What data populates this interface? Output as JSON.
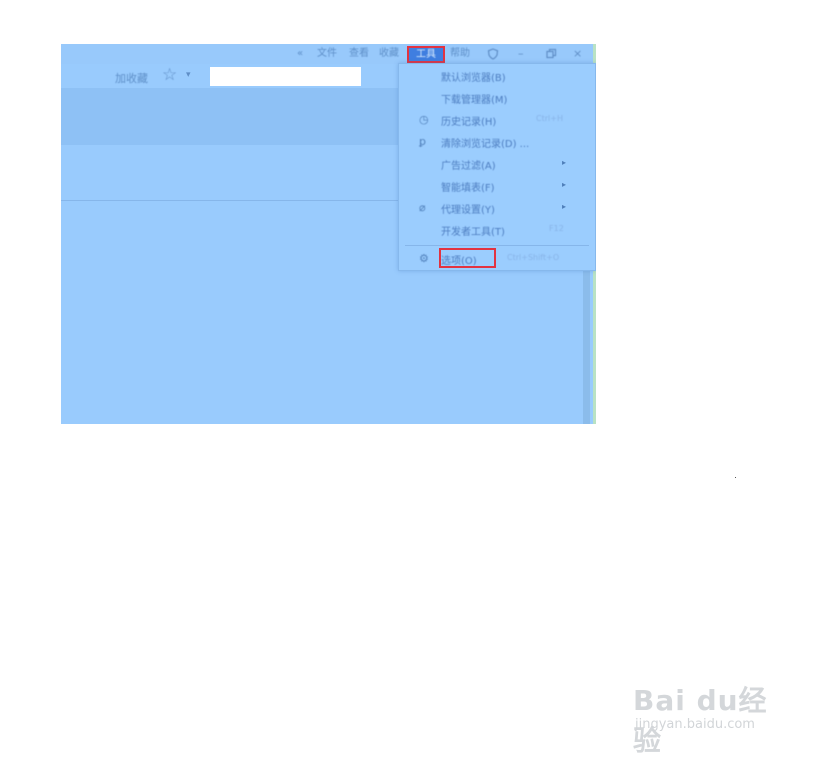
{
  "menubar": {
    "collapse_icon": "double-chevron-icon",
    "items": [
      "文件",
      "查看",
      "收藏"
    ],
    "tools_label": "工具",
    "help_label": "帮助",
    "shield_icon": "shield-icon",
    "minimize": "–",
    "restore": "▫",
    "close": "×"
  },
  "toolbar": {
    "favorites_label": "加收藏",
    "star_icon": "star-icon",
    "caret": "▾"
  },
  "tools_menu": {
    "items": [
      {
        "icon": "",
        "label": "默认浏览器(B)",
        "shortcut": "",
        "submenu": false
      },
      {
        "icon": "",
        "label": "下载管理器(M)",
        "shortcut": "",
        "submenu": false
      },
      {
        "icon": "clock-icon",
        "label": "历史记录(H)",
        "shortcut": "Ctrl+H",
        "submenu": false
      },
      {
        "icon": "broom-icon",
        "label": "清除浏览记录(D) ...",
        "shortcut": "",
        "submenu": false
      },
      {
        "icon": "",
        "label": "广告过滤(A)",
        "shortcut": "",
        "submenu": true
      },
      {
        "icon": "",
        "label": "智能填表(F)",
        "shortcut": "",
        "submenu": true
      },
      {
        "icon": "link-icon",
        "label": "代理设置(Y)",
        "shortcut": "",
        "submenu": true
      },
      {
        "icon": "",
        "label": "开发者工具(T)",
        "shortcut": "F12",
        "submenu": false
      },
      {
        "icon": "gear-icon",
        "label": "选项(O)",
        "shortcut": "Ctrl+Shift+O",
        "submenu": false
      }
    ],
    "arrow": "▸"
  },
  "watermark": {
    "logo_text": "Bai du经验",
    "site": "jingyan.baidu.com"
  },
  "colors": {
    "window_bg": "#99cbfd",
    "highlight_border": "#e23341",
    "text": "#4d7dc0"
  }
}
